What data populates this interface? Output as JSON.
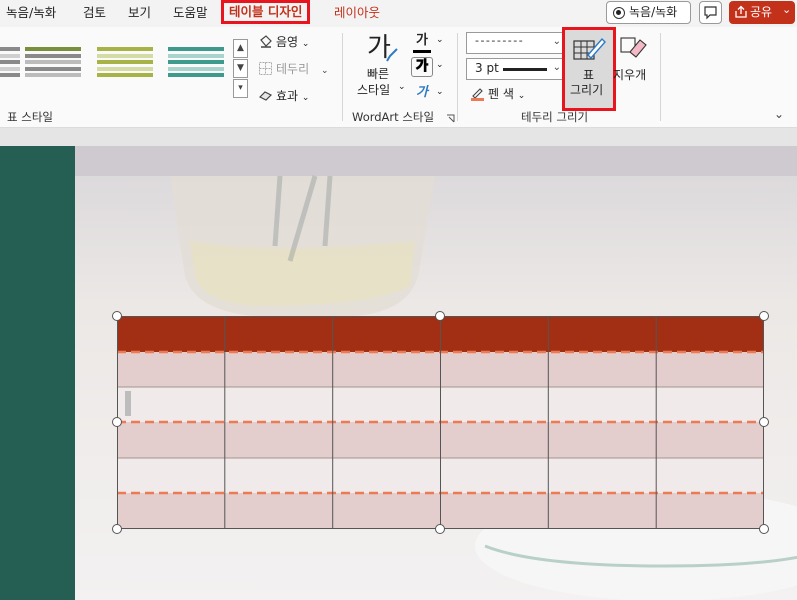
{
  "tabs": [
    {
      "label": "녹음/녹화"
    },
    {
      "label": "검토"
    },
    {
      "label": "보기"
    },
    {
      "label": "도움말"
    },
    {
      "label": "테이블 디자인",
      "active": true
    },
    {
      "label": "레이아웃"
    }
  ],
  "title_actions": {
    "record_label": "녹음/녹화",
    "share_label": "공유",
    "share_chevron": "⌄"
  },
  "ribbon": {
    "table_styles": {
      "group_label": "표 스타일",
      "swatch_colors": [
        "#8a8a8a",
        "#7a8f3e",
        "#a7b347",
        "#3d9a8c"
      ],
      "shading_label": "음영",
      "borders_label": "테두리",
      "effects_label": "효과"
    },
    "wordart": {
      "group_label": "WordArt 스타일",
      "quick_style_label_1": "빠른",
      "quick_style_label_2": "스타일",
      "quick_style_glyph": "가",
      "text_fill_glyph": "가",
      "text_outline_glyph": "가",
      "text_effects_glyph": "가"
    },
    "draw_borders": {
      "group_label": "테두리 그리기",
      "pen_style_value": "- - - - - - - - -",
      "pen_weight_value": "3 pt",
      "pen_color_label": "펜 색",
      "draw_table_label_1": "표",
      "draw_table_label_2": "그리기",
      "eraser_label": "지우개"
    }
  },
  "slide_table": {
    "columns": 6,
    "header_color": "#a22f13",
    "body_color": "#e3cdcd",
    "border_color": "#555555",
    "dashed_border_color": "#ec7a55"
  }
}
